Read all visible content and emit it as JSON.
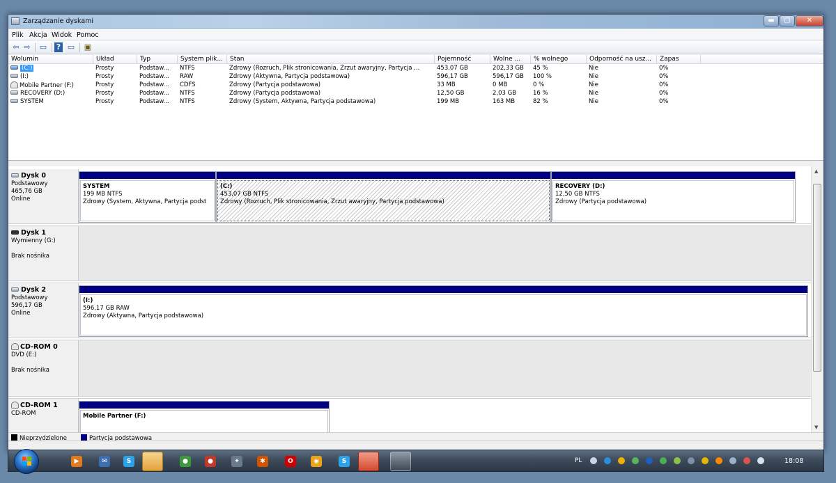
{
  "window": {
    "title": "Zarządzanie dyskami",
    "minimize": "▬",
    "maximize": "▢",
    "close": "✕"
  },
  "menu": [
    "Plik",
    "Akcja",
    "Widok",
    "Pomoc"
  ],
  "toolbar": {
    "back": "⇦",
    "forward": "⇨",
    "props": "▭",
    "help": "?",
    "view": "▭",
    "refresh": "▣"
  },
  "volume_table": {
    "headers": [
      "Wolumin",
      "Układ",
      "Typ",
      "System plik...",
      "Stan",
      "Pojemność",
      "Wolne ...",
      "% wolnego",
      "Odporność na usz...",
      "Zapas"
    ],
    "rows": [
      {
        "name": "(C:)",
        "layout": "Prosty",
        "type": "Podstaw...",
        "fs": "NTFS",
        "status": "Zdrowy (Rozruch, Plik stronicowania, Zrzut awaryjny, Partycja ...",
        "capacity": "453,07 GB",
        "free": "202,33 GB",
        "pct": "45 %",
        "fault": "Nie",
        "overhead": "0%"
      },
      {
        "name": "(I:)",
        "layout": "Prosty",
        "type": "Podstaw...",
        "fs": "RAW",
        "status": "Zdrowy (Aktywna, Partycja podstawowa)",
        "capacity": "596,17 GB",
        "free": "596,17 GB",
        "pct": "100 %",
        "fault": "Nie",
        "overhead": "0%"
      },
      {
        "name": "Mobile Partner (F:)",
        "layout": "Prosty",
        "type": "Podstaw...",
        "fs": "CDFS",
        "status": "Zdrowy (Partycja podstawowa)",
        "capacity": "33 MB",
        "free": "0 MB",
        "pct": "0 %",
        "fault": "Nie",
        "overhead": "0%"
      },
      {
        "name": "RECOVERY (D:)",
        "layout": "Prosty",
        "type": "Podstaw...",
        "fs": "NTFS",
        "status": "Zdrowy (Partycja podstawowa)",
        "capacity": "12,50 GB",
        "free": "2,03 GB",
        "pct": "16 %",
        "fault": "Nie",
        "overhead": "0%"
      },
      {
        "name": "SYSTEM",
        "layout": "Prosty",
        "type": "Podstaw...",
        "fs": "NTFS",
        "status": "Zdrowy (System, Aktywna, Partycja podstawowa)",
        "capacity": "199 MB",
        "free": "163 MB",
        "pct": "82 %",
        "fault": "Nie",
        "overhead": "0%"
      }
    ]
  },
  "disks": [
    {
      "title": "Dysk 0",
      "l1": "Podstawowy",
      "l2": "465,76 GB",
      "l3": "Online",
      "parts": [
        {
          "name": "SYSTEM",
          "size": "199 MB NTFS",
          "status": "Zdrowy (System, Aktywna, Partycja podst"
        },
        {
          "name": "(C:)",
          "size": "453,07 GB NTFS",
          "status": "Zdrowy (Rozruch, Plik stronicowania, Zrzut awaryjny, Partycja podstawowa)"
        },
        {
          "name": "RECOVERY  (D:)",
          "size": "12,50 GB NTFS",
          "status": "Zdrowy (Partycja podstawowa)"
        }
      ]
    },
    {
      "title": "Dysk 1",
      "l1": "Wymienny (G:)",
      "l2": "",
      "l3": "Brak nośnika"
    },
    {
      "title": "Dysk 2",
      "l1": "Podstawowy",
      "l2": "596,17 GB",
      "l3": "Online",
      "parts": [
        {
          "name": "(I:)",
          "size": "596,17 GB RAW",
          "status": "Zdrowy (Aktywna, Partycja podstawowa)"
        }
      ]
    },
    {
      "title": "CD-ROM 0",
      "l1": "DVD (E:)",
      "l2": "",
      "l3": "Brak nośnika"
    },
    {
      "title": "CD-ROM 1",
      "l1": "CD-ROM",
      "l2": "",
      "l3": "",
      "parts": [
        {
          "name": "Mobile Partner  (F:)",
          "size": "",
          "status": ""
        }
      ]
    }
  ],
  "legend": {
    "unallocated": "Nieprzydzielone",
    "primary": "Partycja podstawowa"
  },
  "colors": {
    "primary_partition": "#000080",
    "unallocated": "#000000",
    "selection": "#3399ff"
  },
  "taskbar": {
    "lang": "PL",
    "time": "18:08"
  }
}
